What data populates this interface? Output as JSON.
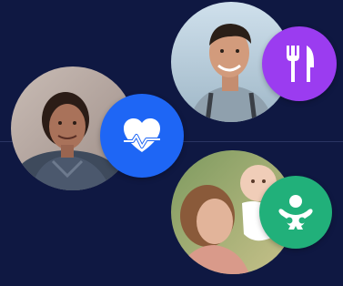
{
  "colors": {
    "background": "#0f1842",
    "divider": "#2a3563",
    "heart_badge": "#1e66f5",
    "dining_badge": "#9b3cf0",
    "baby_badge": "#21b07a",
    "icon": "#ffffff"
  },
  "items": [
    {
      "photo": "elderly-woman-photo",
      "icon": "heart-pulse-icon"
    },
    {
      "photo": "smiling-man-photo",
      "icon": "fork-knife-icon"
    },
    {
      "photo": "mother-and-baby-photo",
      "icon": "baby-icon"
    }
  ]
}
